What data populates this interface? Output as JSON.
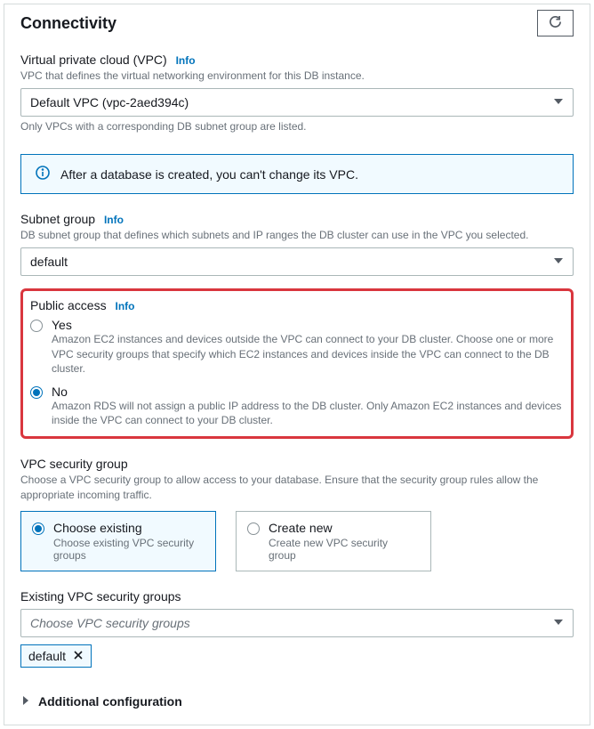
{
  "header": {
    "title": "Connectivity"
  },
  "vpc": {
    "label": "Virtual private cloud (VPC)",
    "info": "Info",
    "desc": "VPC that defines the virtual networking environment for this DB instance.",
    "value": "Default VPC (vpc-2aed394c)",
    "hint": "Only VPCs with a corresponding DB subnet group are listed."
  },
  "alert": {
    "text": "After a database is created, you can't change its VPC."
  },
  "subnet": {
    "label": "Subnet group",
    "info": "Info",
    "desc": "DB subnet group that defines which subnets and IP ranges the DB cluster can use in the VPC you selected.",
    "value": "default"
  },
  "public_access": {
    "label": "Public access",
    "info": "Info",
    "options": [
      {
        "label": "Yes",
        "desc": "Amazon EC2 instances and devices outside the VPC can connect to your DB cluster. Choose one or more VPC security groups that specify which EC2 instances and devices inside the VPC can connect to the DB cluster.",
        "selected": false
      },
      {
        "label": "No",
        "desc": "Amazon RDS will not assign a public IP address to the DB cluster. Only Amazon EC2 instances and devices inside the VPC can connect to your DB cluster.",
        "selected": true
      }
    ]
  },
  "sg": {
    "label": "VPC security group",
    "desc": "Choose a VPC security group to allow access to your database. Ensure that the security group rules allow the appropriate incoming traffic.",
    "options": [
      {
        "title": "Choose existing",
        "desc": "Choose existing VPC security groups",
        "selected": true
      },
      {
        "title": "Create new",
        "desc": "Create new VPC security group",
        "selected": false
      }
    ]
  },
  "existing_sg": {
    "label": "Existing VPC security groups",
    "placeholder": "Choose VPC security groups",
    "token": "default"
  },
  "expander": {
    "label": "Additional configuration"
  }
}
